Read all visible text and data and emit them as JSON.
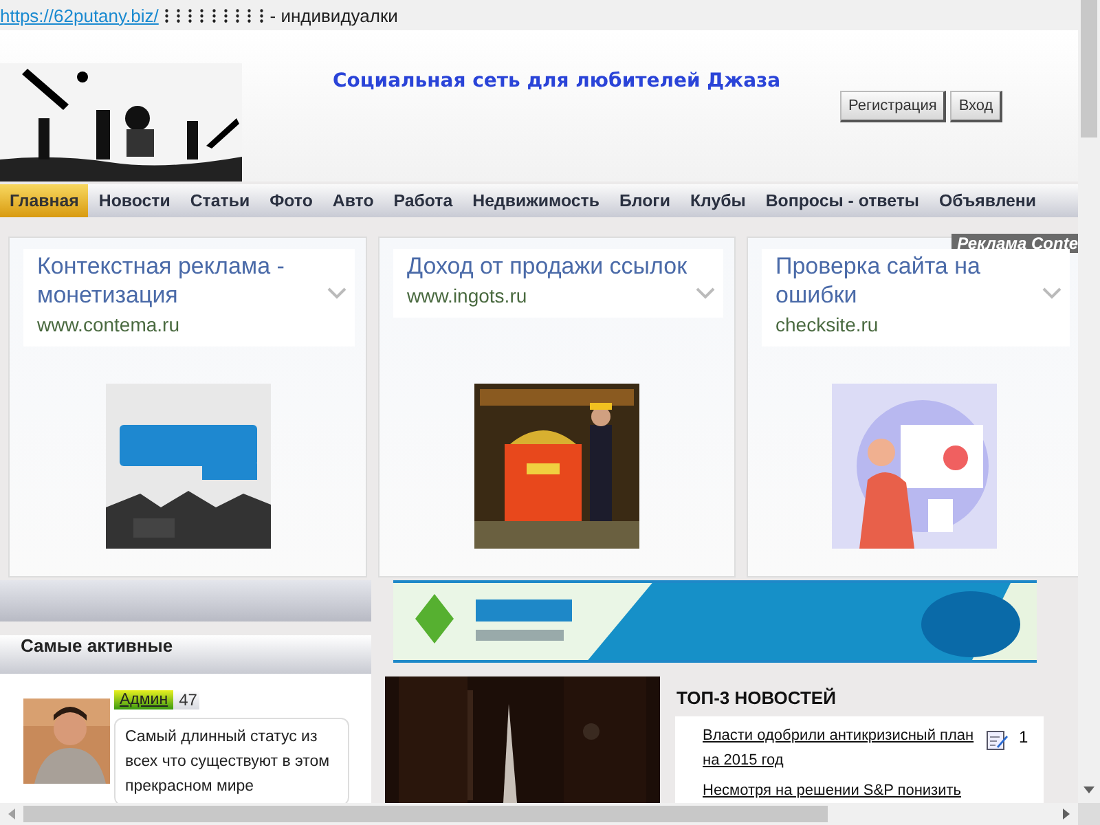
{
  "top_bar": {
    "link": "https://62putany.biz/",
    "marks": "⁝ ⁝ ⁝ ⁝ ⁝ ⁝ ⁝ ⁝ ⁝",
    "text": "- индивидуалки"
  },
  "header": {
    "title": "Социальная сеть для любителей Джаза",
    "buttons": [
      "Регистрация",
      "Вход"
    ]
  },
  "nav": [
    {
      "label": "Главная",
      "selected": true
    },
    {
      "label": "Новости",
      "selected": false
    },
    {
      "label": "Статьи",
      "selected": false
    },
    {
      "label": "Фото",
      "selected": false
    },
    {
      "label": "Авто",
      "selected": false
    },
    {
      "label": "Работа",
      "selected": false
    },
    {
      "label": "Недвижимость",
      "selected": false
    },
    {
      "label": "Блоги",
      "selected": false
    },
    {
      "label": "Клубы",
      "selected": false
    },
    {
      "label": "Вопросы - ответы",
      "selected": false
    },
    {
      "label": "Объявлени",
      "selected": false
    }
  ],
  "ads": {
    "label": "Реклама Conte",
    "cards": [
      {
        "title": "Контекстная реклама - монетизация",
        "url": "www.contema.ru"
      },
      {
        "title": "Доход от продажи ссылок",
        "url": "www.ingots.ru"
      },
      {
        "title": "Проверка сайта на ошибки",
        "url": "checksite.ru"
      }
    ]
  },
  "sidebar": {
    "heading": "Самые активные",
    "users": [
      {
        "role": "Админ",
        "count": "47",
        "status": "Самый длинный статус из всех что существуют в этом прекрасном мире"
      }
    ]
  },
  "news": {
    "heading": "ТОП-3 НОВОСТЕЙ",
    "items": [
      {
        "title": "Власти одобрили антикризисный план на 2015 год",
        "comments": "1"
      },
      {
        "title": "Несмотря на решении S&P понизить"
      }
    ]
  }
}
